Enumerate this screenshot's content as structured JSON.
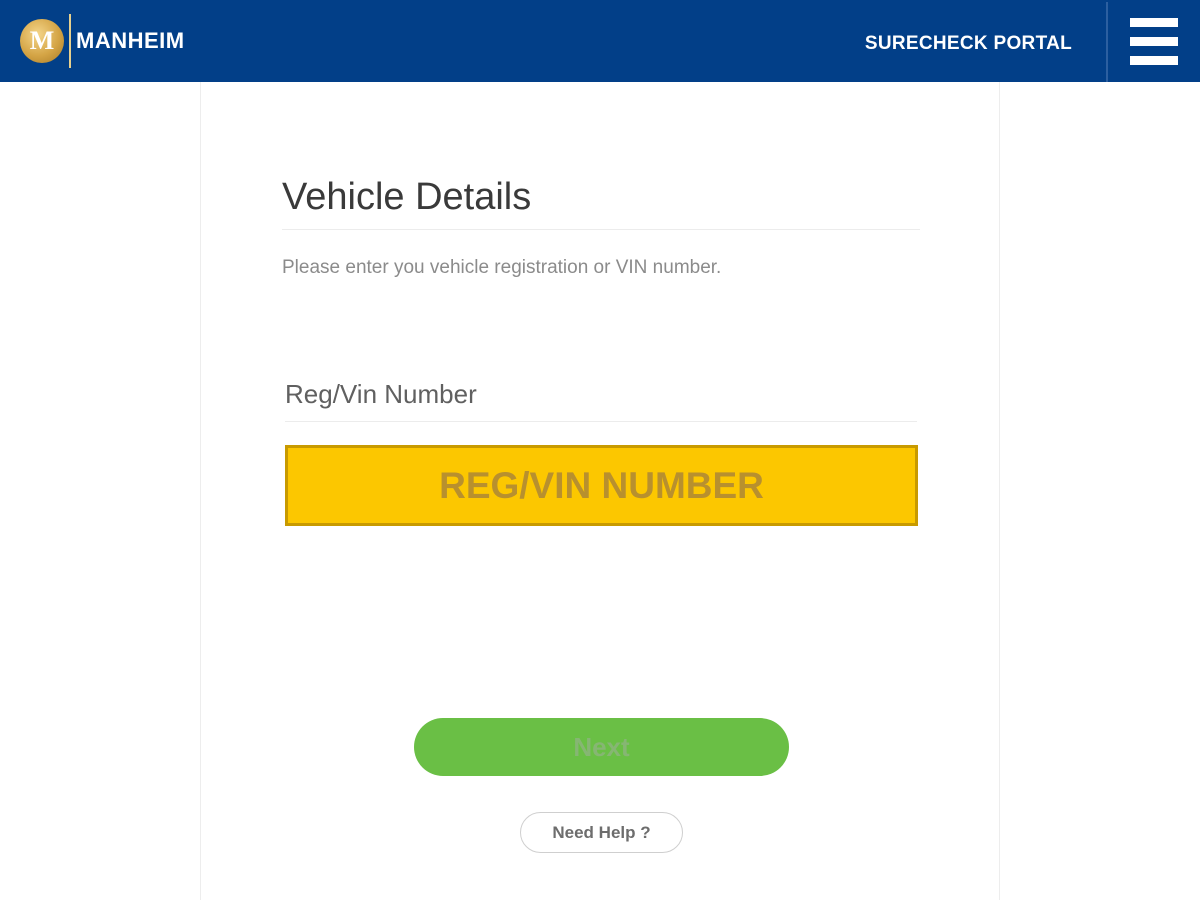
{
  "header": {
    "logo_icon": "manheim-m-logo-icon",
    "logo_letter": "M",
    "brand_name": "MANHEIM",
    "portal_title": "SURECHECK PORTAL",
    "menu_icon": "hamburger-menu-icon",
    "background_color": "#023f88"
  },
  "main": {
    "title": "Vehicle Details",
    "instructions": "Please enter you vehicle registration or VIN number.",
    "field_label": "Reg/Vin Number",
    "reg_input": {
      "value": "",
      "placeholder": "REG/VIN NUMBER",
      "background_color": "#fcc700"
    },
    "next_label": "Next",
    "next_color": "#6abf45",
    "help_label": "Need Help ?"
  }
}
